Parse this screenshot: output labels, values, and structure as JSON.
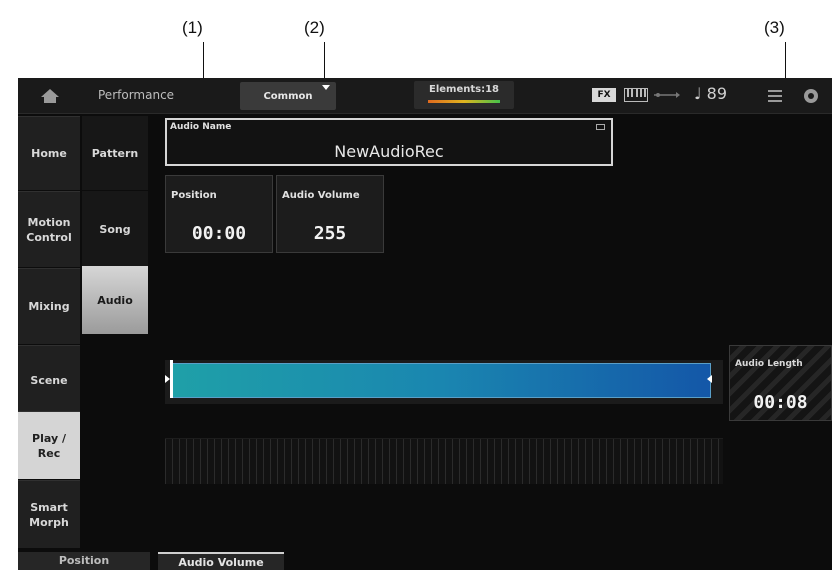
{
  "callouts": [
    "(1)",
    "(2)",
    "(3)"
  ],
  "topbar": {
    "title": "Performance",
    "common_tab": "Common",
    "elements": "Elements:18",
    "fx": "FX",
    "tempo": "♩ 89"
  },
  "nav_primary": [
    {
      "label": "Home"
    },
    {
      "label": "Motion Control"
    },
    {
      "label": "Mixing"
    },
    {
      "label": "Scene"
    },
    {
      "label": "Play / Rec",
      "selected": true
    },
    {
      "label": "Smart Morph"
    }
  ],
  "nav_secondary": [
    {
      "label": "Pattern"
    },
    {
      "label": "Song"
    },
    {
      "label": "Audio",
      "selected": true
    }
  ],
  "audio_name": {
    "label": "Audio Name",
    "value": "NewAudioRec"
  },
  "position": {
    "label": "Position",
    "value": "00:00"
  },
  "audio_volume": {
    "label": "Audio Volume",
    "value": "255"
  },
  "audio_length": {
    "label": "Audio Length",
    "value": "00:08"
  },
  "bottom_tabs": [
    {
      "label": "Position"
    },
    {
      "label": "Audio Volume",
      "active": true
    }
  ],
  "colors": {
    "waveform_start": "#1fa0a8",
    "waveform_end": "#1457a8",
    "screen_bg": "#0c0c0c"
  }
}
